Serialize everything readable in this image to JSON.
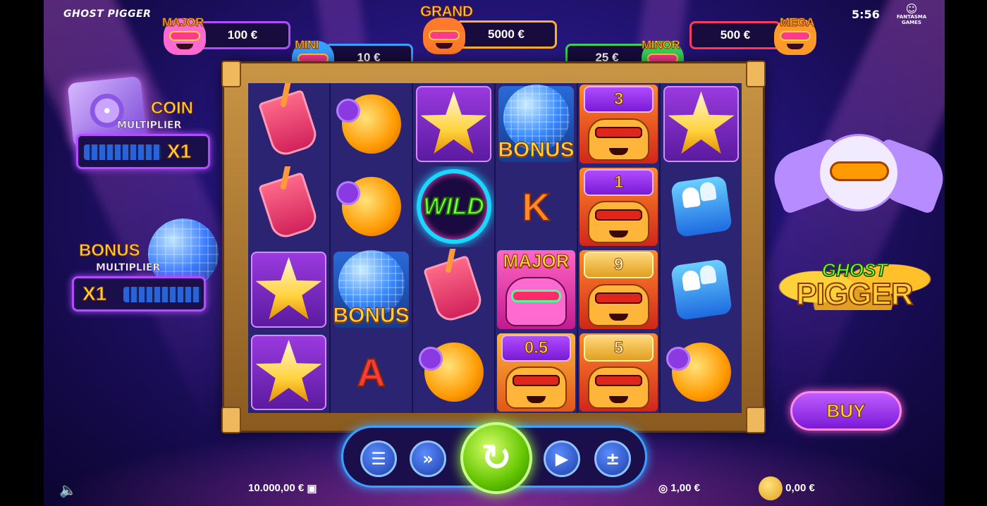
{
  "game_title": "GHOST PIGGER",
  "clock": "5:56",
  "studio": {
    "line1": "FANTASMA",
    "line2": "GAMES"
  },
  "jackpots": [
    {
      "name": "MAJOR",
      "value": "100 €",
      "color": "#b24cff"
    },
    {
      "name": "MINI",
      "value": "10 €",
      "color": "#3aa0ff"
    },
    {
      "name": "GRAND",
      "value": "5000 €",
      "color": "#ffb020"
    },
    {
      "name": "MINOR",
      "value": "25 €",
      "color": "#3ad05a"
    },
    {
      "name": "MEGA",
      "value": "500 €",
      "color": "#ff3a5a"
    }
  ],
  "coin_multiplier": {
    "line1": "COIN",
    "line2": "MULTIPLIER",
    "value": "X1"
  },
  "bonus_multiplier": {
    "line1": "BONUS",
    "line2": "MULTIPLIER",
    "value": "X1"
  },
  "reels": {
    "bonus_label": "BONUS",
    "wild_label": "WILD",
    "major_label": "MAJOR",
    "letter_k": "K",
    "letter_a": "A",
    "col5_values": [
      "3",
      "1",
      "9",
      "5"
    ],
    "col4_value": "0.5"
  },
  "controls": {
    "buy_label": "BUY"
  },
  "footer": {
    "balance": "10.000,00 €",
    "bet": "1,00 €",
    "win": "0,00 €"
  },
  "logo": {
    "line1": "GHOST",
    "line2": "PIGGER"
  }
}
